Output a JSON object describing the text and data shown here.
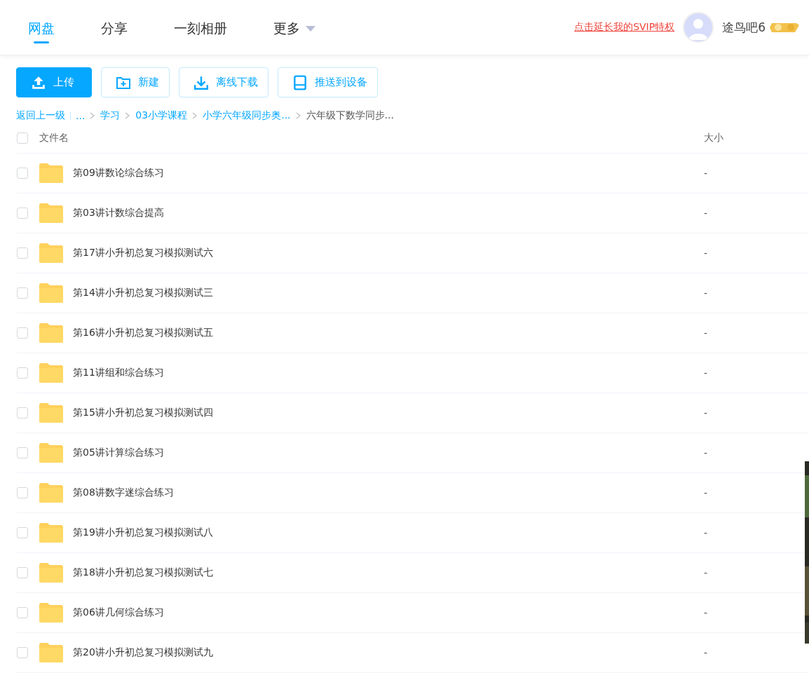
{
  "nav": {
    "tabs": [
      {
        "label": "网盘",
        "selected": true
      },
      {
        "label": "分享",
        "selected": false
      },
      {
        "label": "一刻相册",
        "selected": false
      },
      {
        "label": "更多",
        "selected": false,
        "dropdown": true
      }
    ],
    "promo_link": "点击延长我的SVIP特权",
    "username": "途鸟吧6"
  },
  "toolbar": [
    {
      "label": "上传",
      "kind": "upload"
    },
    {
      "label": "新建",
      "kind": "new-folder"
    },
    {
      "label": "离线下载",
      "kind": "download"
    },
    {
      "label": "推送到设备",
      "kind": "device"
    }
  ],
  "breadcrumb": [
    {
      "label": "返回上一级",
      "kind": "back"
    },
    {
      "label": "...",
      "kind": "link"
    },
    {
      "label": "学习",
      "kind": "link"
    },
    {
      "label": "03小学课程",
      "kind": "link"
    },
    {
      "label": "小学六年级同步奥...",
      "kind": "link"
    },
    {
      "label": "六年级下数学同步...",
      "kind": "current"
    }
  ],
  "table": {
    "columns": [
      "文件名",
      "大小"
    ],
    "all_checked": false,
    "rows": [
      {
        "name": "第09讲数论综合练习",
        "size": "-",
        "checked": false
      },
      {
        "name": "第03讲计数综合提高",
        "size": "-",
        "checked": false
      },
      {
        "name": "第17讲小升初总复习模拟测试六",
        "size": "-",
        "checked": false
      },
      {
        "name": "第14讲小升初总复习模拟测试三",
        "size": "-",
        "checked": false
      },
      {
        "name": "第16讲小升初总复习模拟测试五",
        "size": "-",
        "checked": false
      },
      {
        "name": "第11讲组和综合练习",
        "size": "-",
        "checked": false
      },
      {
        "name": "第15讲小升初总复习模拟测试四",
        "size": "-",
        "checked": false
      },
      {
        "name": "第05讲计算综合练习",
        "size": "-",
        "checked": false
      },
      {
        "name": "第08讲数字迷综合练习",
        "size": "-",
        "checked": false
      },
      {
        "name": "第19讲小升初总复习模拟测试八",
        "size": "-",
        "checked": false
      },
      {
        "name": "第18讲小升初总复习模拟测试七",
        "size": "-",
        "checked": false
      },
      {
        "name": "第06讲几何综合练习",
        "size": "-",
        "checked": false
      },
      {
        "name": "第20讲小升初总复习模拟测试九",
        "size": "-",
        "checked": false
      }
    ]
  }
}
